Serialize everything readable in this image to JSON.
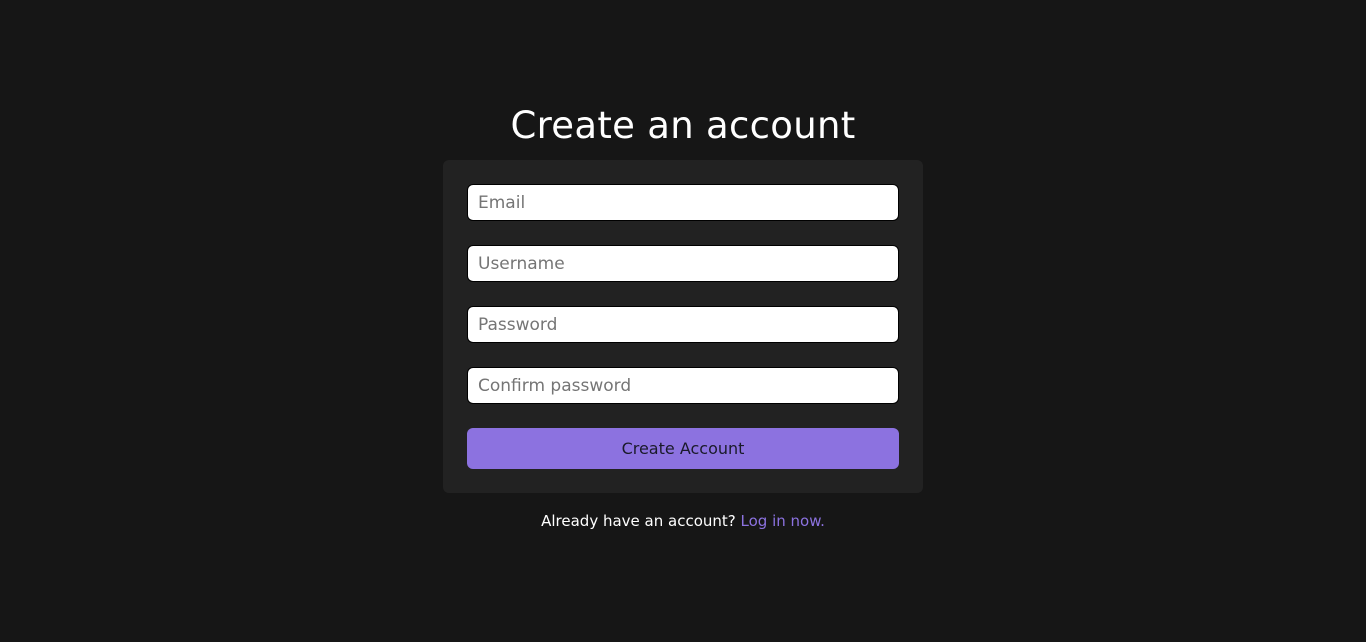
{
  "page": {
    "title": "Create an account"
  },
  "form": {
    "email_placeholder": "Email",
    "username_placeholder": "Username",
    "password_placeholder": "Password",
    "confirm_password_placeholder": "Confirm password",
    "submit_label": "Create Account"
  },
  "footer": {
    "prompt": "Already have an account?",
    "login_link": "Log in now."
  },
  "colors": {
    "background": "#161616",
    "card": "#222222",
    "accent": "#8c72e0",
    "text": "#ffffff"
  }
}
